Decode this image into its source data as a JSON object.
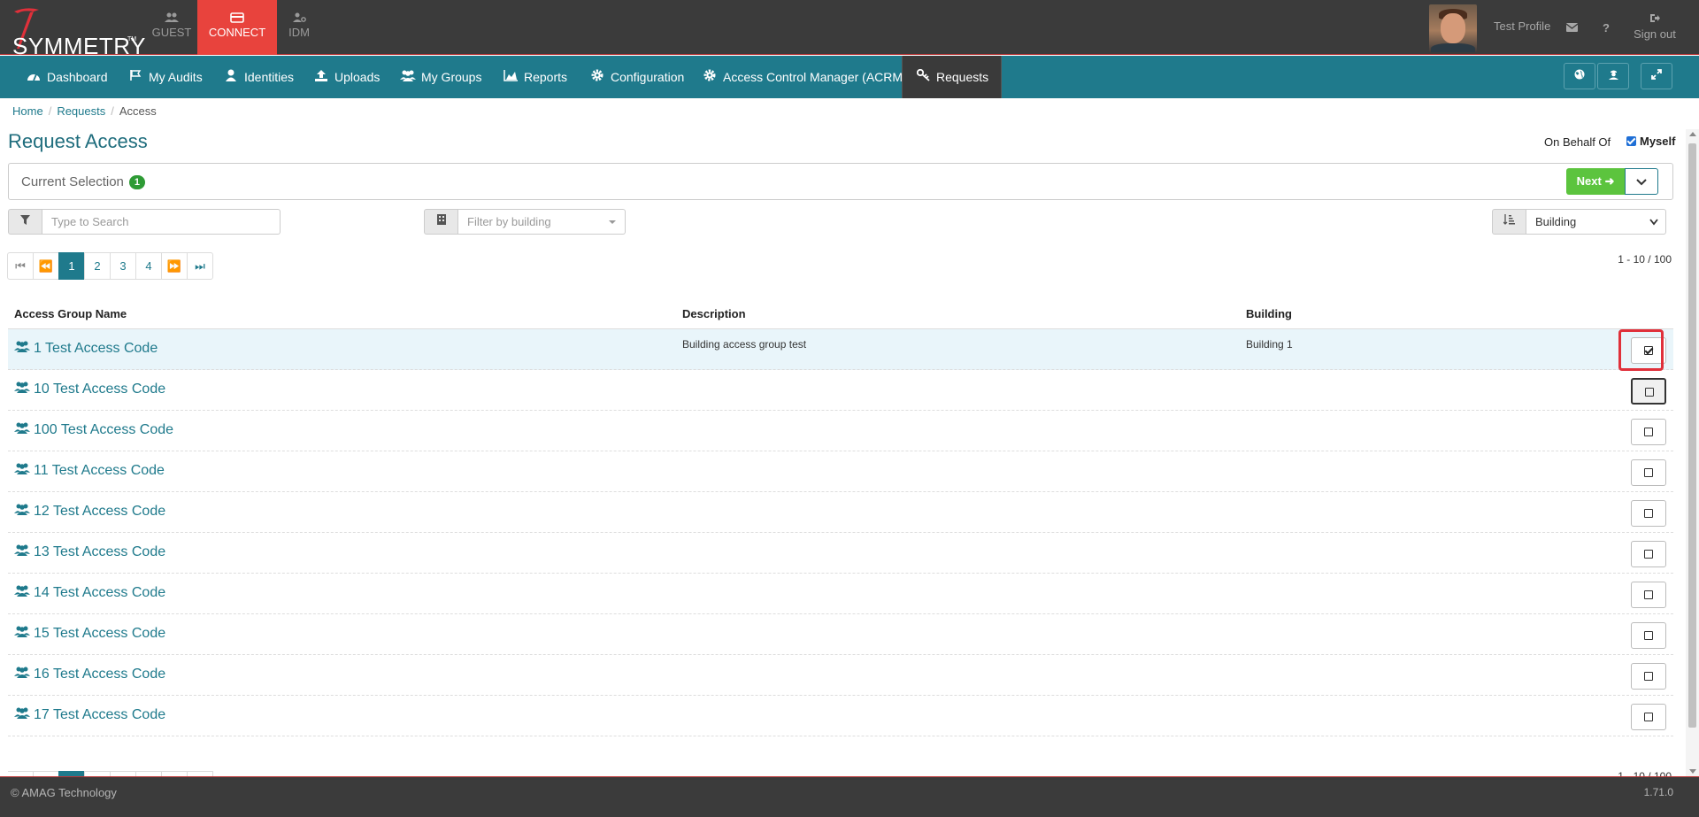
{
  "brand": {
    "name": "SYMMETRY",
    "tm": "TM"
  },
  "app_tabs": [
    {
      "label": "GUEST",
      "icon": "users-icon"
    },
    {
      "label": "CONNECT",
      "icon": "card-icon"
    },
    {
      "label": "IDM",
      "icon": "user-gear-icon"
    }
  ],
  "user": {
    "profile_name": "Test Profile",
    "signout_label": "Sign out",
    "help_label": "?"
  },
  "nav": [
    {
      "label": "Dashboard",
      "icon": "dashboard-icon"
    },
    {
      "label": "My Audits",
      "icon": "flag-icon"
    },
    {
      "label": "Identities",
      "icon": "user-icon"
    },
    {
      "label": "Uploads",
      "icon": "upload-icon"
    },
    {
      "label": "My Groups",
      "icon": "users-icon"
    },
    {
      "label": "Reports",
      "icon": "area-chart-icon"
    },
    {
      "label": "Configuration",
      "icon": "cog-icon"
    },
    {
      "label": "Access Control Manager (ACRM)",
      "icon": "cog-icon"
    },
    {
      "label": "Requests",
      "icon": "key-icon"
    }
  ],
  "breadcrumb": [
    "Home",
    "Requests",
    "Access"
  ],
  "page": {
    "title": "Request Access",
    "on_behalf_label": "On Behalf Of",
    "myself_label": "Myself",
    "myself_checked": true
  },
  "selection": {
    "label": "Current Selection",
    "count": "1",
    "next_label": "Next"
  },
  "filters": {
    "search_placeholder": "Type to Search",
    "building_placeholder": "Filter by building",
    "sort_value": "Building"
  },
  "pagination": {
    "pages": [
      "1",
      "2",
      "3",
      "4"
    ],
    "current": "1",
    "range": "1 - 10 / 100"
  },
  "table": {
    "headers": [
      "Access Group Name",
      "Description",
      "Building"
    ],
    "rows": [
      {
        "name": "1 Test Access Code",
        "description": "Building access group test",
        "building": "Building 1",
        "checked": true
      },
      {
        "name": "10 Test Access Code",
        "description": "",
        "building": "",
        "checked": false
      },
      {
        "name": "100 Test Access Code",
        "description": "",
        "building": "",
        "checked": false
      },
      {
        "name": "11 Test Access Code",
        "description": "",
        "building": "",
        "checked": false
      },
      {
        "name": "12 Test Access Code",
        "description": "",
        "building": "",
        "checked": false
      },
      {
        "name": "13 Test Access Code",
        "description": "",
        "building": "",
        "checked": false
      },
      {
        "name": "14 Test Access Code",
        "description": "",
        "building": "",
        "checked": false
      },
      {
        "name": "15 Test Access Code",
        "description": "",
        "building": "",
        "checked": false
      },
      {
        "name": "16 Test Access Code",
        "description": "",
        "building": "",
        "checked": false
      },
      {
        "name": "17 Test Access Code",
        "description": "",
        "building": "",
        "checked": false
      }
    ]
  },
  "footer": {
    "copyright": "© AMAG Technology",
    "version": "1.71.0"
  },
  "colors": {
    "nav": "#1f7a8c",
    "top": "#3b3b3b",
    "accent_red": "#e8433d",
    "next_green": "#5cc43e"
  }
}
